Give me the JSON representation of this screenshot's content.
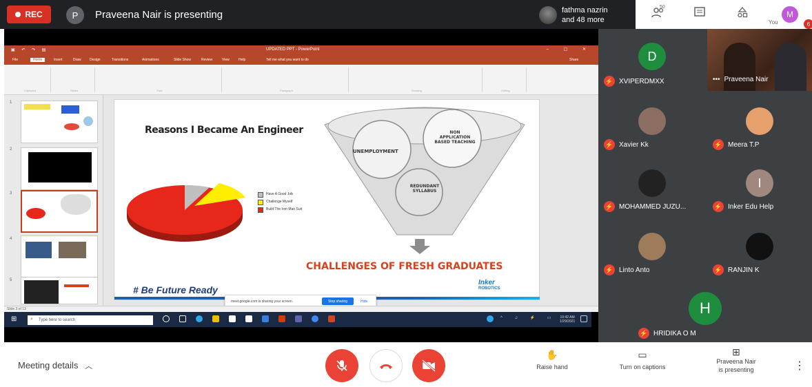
{
  "topbar": {
    "rec_label": "REC",
    "presenter_initial": "P",
    "presenting_text": "Praveena Nair is presenting",
    "others_line1": "fathma nazrin",
    "others_line2": "and 48 more",
    "people_count": "50",
    "me_initial": "M",
    "you_label": "You",
    "notification_count": "6"
  },
  "ppt": {
    "window_title": "UPDATED PPT - PowerPoint",
    "tabs": [
      "File",
      "Home",
      "Insert",
      "Draw",
      "Design",
      "Transitions",
      "Animations",
      "Slide Show",
      "Review",
      "View",
      "Help",
      "Tell me what you want to do",
      "Share"
    ],
    "ribbon_groups": [
      "Clipboard",
      "Slides",
      "Font",
      "Paragraph",
      "Drawing",
      "Editing"
    ],
    "slide_numbers": [
      "1",
      "2",
      "3",
      "4",
      "5"
    ],
    "status_text": "Slide 3 of 13",
    "slide": {
      "title": "Reasons I Became An Engineer",
      "legend": [
        {
          "label": "Have A Good Job",
          "color": "#bfbfbf"
        },
        {
          "label": "Challenge Myself",
          "color": "#ffee00"
        },
        {
          "label": "Build The Iron Man Suit",
          "color": "#e8271b"
        }
      ],
      "funnel_labels": {
        "unemployment": "UNEMPLOYMENT",
        "non_app_1": "NON",
        "non_app_2": "APPLICATION",
        "non_app_3": "BASED TEACHING",
        "redundant_1": "REDUNDANT",
        "redundant_2": "SYLLABUS"
      },
      "challenges": "CHALLENGES OF FRESH GRADUATES",
      "footer": "# Be Future Ready",
      "logo_line1": "Inker",
      "logo_line2": "ROBOTICS"
    },
    "share_toast": {
      "message": "meet.google.com is sharing your screen.",
      "stop_label": "Stop sharing",
      "hide_label": "Hide"
    }
  },
  "taskbar": {
    "search_placeholder": "Type here to search",
    "time": "10:42 AM",
    "date": "1/29/2021"
  },
  "participants": [
    {
      "initial": "D",
      "name": "XVIPERDMXX",
      "color": "#1e8e3e"
    },
    {
      "initial": "",
      "name": "Xavier Kk",
      "color": "#8d6e63"
    },
    {
      "initial": "",
      "name": "Meera T.P",
      "color": "#e6a06b"
    },
    {
      "initial": "",
      "name": "MOHAMMED JUZU...",
      "color": "#222222"
    },
    {
      "initial": "I",
      "name": "Inker Edu Help",
      "color": "#a1887f"
    },
    {
      "initial": "",
      "name": "Linto Anto",
      "color": "#9e7b5a"
    },
    {
      "initial": "",
      "name": "RANJIN K",
      "color": "#111111"
    },
    {
      "initial": "H",
      "name": "HRIDIKA O M",
      "color": "#1e8e3e"
    }
  ],
  "presenter_tile": {
    "name": "Praveena Nair"
  },
  "bottombar": {
    "meeting_details": "Meeting details",
    "raise_hand": "Raise hand",
    "captions": "Turn on captions",
    "presenting_line1": "Praveena Nair",
    "presenting_line2": "is presenting"
  },
  "colors": {
    "accent_red": "#ea4335",
    "meet_dark": "#202124",
    "tile_bg": "#3c4043",
    "ppt_red": "#b7472a"
  }
}
